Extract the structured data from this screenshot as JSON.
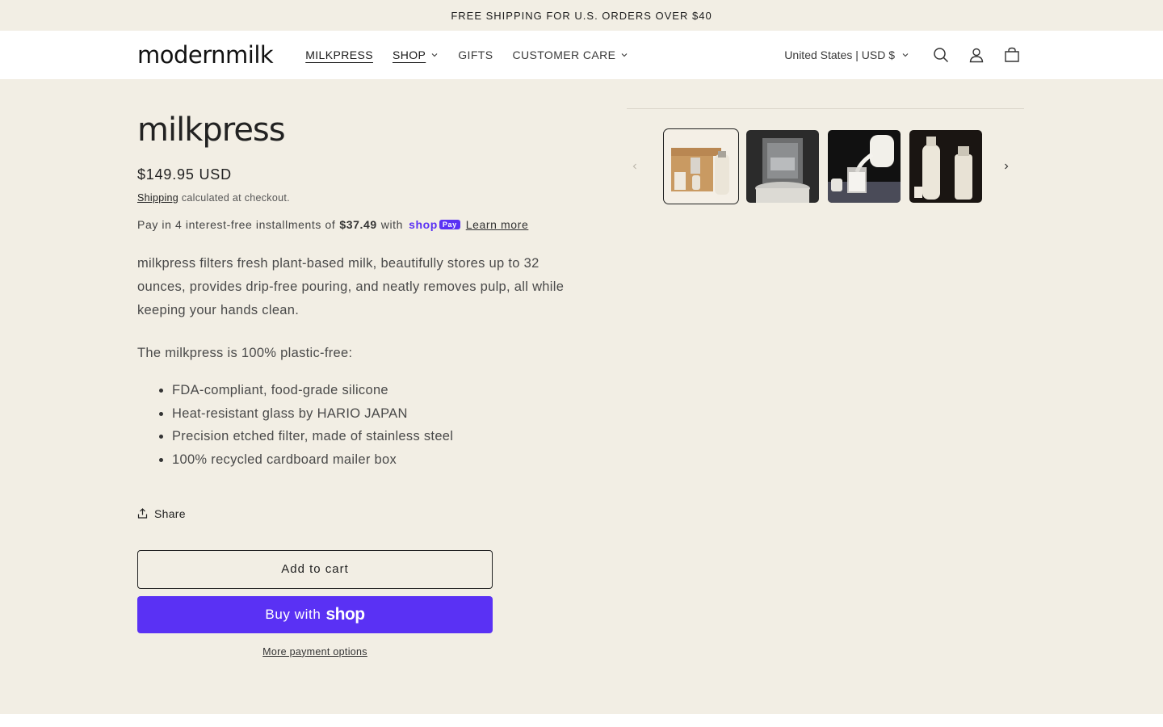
{
  "announcement": "FREE SHIPPING FOR U.S. ORDERS OVER $40",
  "header": {
    "logo": "modernmilk",
    "nav": [
      {
        "label": "MILKPRESS",
        "has_dropdown": false
      },
      {
        "label": "SHOP",
        "has_dropdown": true
      },
      {
        "label": "GIFTS",
        "has_dropdown": false
      },
      {
        "label": "CUSTOMER CARE",
        "has_dropdown": true
      }
    ],
    "country": "United States | USD $",
    "icons": [
      "search-icon",
      "account-icon",
      "cart-icon"
    ]
  },
  "product": {
    "title": "milkpress",
    "price": "$149.95 USD",
    "shipping_link": "Shipping",
    "shipping_rest": "calculated at checkout.",
    "installments_prefix": "Pay in 4 interest-free installments of",
    "installments_amount": "$37.49",
    "installments_with": "with",
    "shoppay_word": "shop",
    "shoppay_badge": "Pay",
    "learn_more": "Learn more",
    "description": "milkpress filters fresh plant-based milk, beautifully stores up to 32 ounces, provides drip-free pouring, and neatly removes pulp, all while keeping your hands clean.",
    "plastic_free": "The milkpress is 100% plastic-free:",
    "bullets": [
      "FDA-compliant, food-grade silicone",
      "Heat-resistant glass by HARIO JAPAN",
      "Precision etched filter, made of stainless steel",
      "100% recycled cardboard mailer box"
    ],
    "share": "Share",
    "add_to_cart": "Add to cart",
    "buy_with": "Buy with",
    "buy_shop": "shop",
    "more_payment": "More payment options"
  },
  "gallery": {
    "thumbnails": [
      "milkpress-box-thumbnail",
      "milkpress-filter-thumbnail",
      "milk-pour-thumbnail",
      "milkpress-bottles-thumbnail"
    ],
    "active_index": 0
  },
  "colors": {
    "background": "#f2eee4",
    "shop_pay_purple": "#5a31f4",
    "text": "#2b2b2b"
  }
}
